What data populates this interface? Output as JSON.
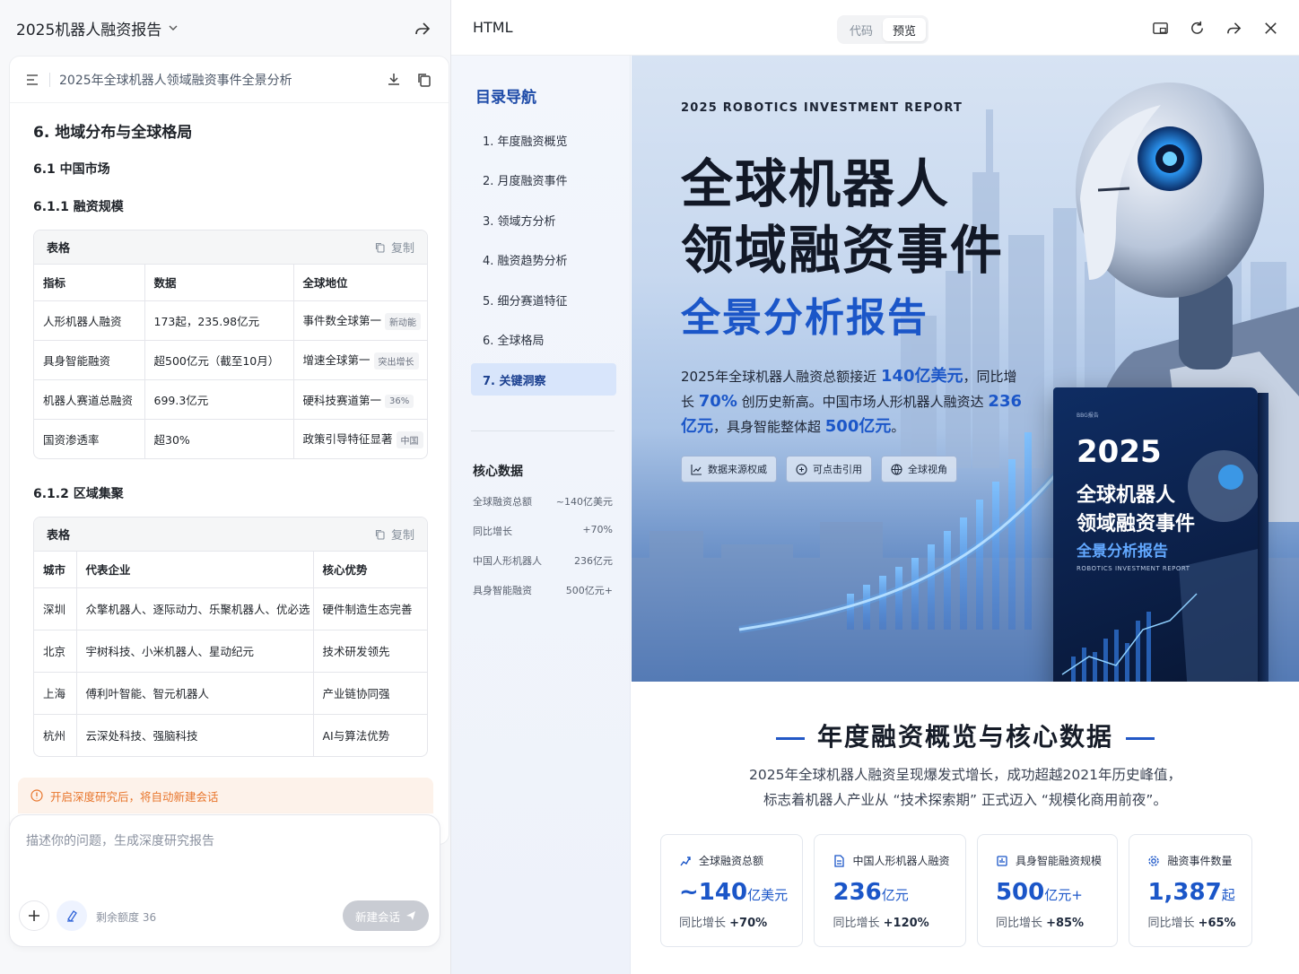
{
  "left": {
    "title": "2025机器人融资报告",
    "doc_name": "2025年全球机器人领域融资事件全景分析",
    "h1": "6. 地域分布与全球格局",
    "h2": "6.1 中国市场",
    "h3a": "6.1.1 融资规模",
    "h3b": "6.1.2 区域集聚",
    "table_label": "表格",
    "copy_label": "复制",
    "table1": {
      "headers": [
        "指标",
        "数据",
        "全球地位"
      ],
      "rows": [
        {
          "c1": "人形机器人融资",
          "c2": "173起，235.98亿元",
          "c3": "事件数全球第一",
          "tag": "新动能"
        },
        {
          "c1": "具身智能融资",
          "c2": "超500亿元（截至10月）",
          "c3": "增速全球第一",
          "tag": "突出增长"
        },
        {
          "c1": "机器人赛道总融资",
          "c2": "699.3亿元",
          "c3": "硬科技赛道第一",
          "tag": "36%"
        },
        {
          "c1": "国资渗透率",
          "c2": "超30%",
          "c3": "政策引导特征显著",
          "tag": "中国"
        }
      ]
    },
    "table2": {
      "headers": [
        "城市",
        "代表企业",
        "核心优势"
      ],
      "rows": [
        {
          "c1": "深圳",
          "c2": "众擎机器人、逐际动力、乐聚机器人、优必选",
          "c3": "硬件制造生态完善"
        },
        {
          "c1": "北京",
          "c2": "宇树科技、小米机器人、星动纪元",
          "c3": "技术研发领先"
        },
        {
          "c1": "上海",
          "c2": "傅利叶智能、智元机器人",
          "c3": "产业链协同强"
        },
        {
          "c1": "杭州",
          "c2": "云深处科技、强脑科技",
          "c3": "AI与算法优势"
        }
      ]
    },
    "notice": "开启深度研究后，将自动新建会话",
    "composer_placeholder": "描述你的问题，生成深度研究报告",
    "quota": "剩余额度 36",
    "send_label": "新建会话"
  },
  "right": {
    "title": "HTML",
    "seg_code": "代码",
    "seg_preview": "预览",
    "nav_title": "目录导航",
    "nav_items": [
      "1. 年度融资概览",
      "2. 月度融资事件",
      "3. 领域方分析",
      "4. 融资趋势分析",
      "5. 细分赛道特征",
      "6. 全球格局",
      "7. 关键洞察"
    ],
    "kd_title": "核心数据",
    "kd_rows": [
      {
        "k": "全球融资总额",
        "v": "~140亿美元"
      },
      {
        "k": "同比增长",
        "v": "+70%"
      },
      {
        "k": "中国人形机器人",
        "v": "236亿元"
      },
      {
        "k": "具身智能融资",
        "v": "500亿元+"
      }
    ],
    "hero": {
      "kicker": "2025 ROBOTICS INVESTMENT REPORT",
      "line1": "全球机器人",
      "line2": "领域融资事件",
      "line3": "全景分析报告",
      "desc_a": "2025年全球机器人融资总额接近 ",
      "desc_b": "140亿美元",
      "desc_c": "，同比增长 ",
      "desc_d": "70%",
      "desc_e": " 创历史新高。中国市场人形机器人融资达 ",
      "desc_f": "236亿元",
      "desc_g": "，具身智能整体超 ",
      "desc_h": "500亿元",
      "desc_i": "。",
      "pills": [
        "数据来源权威",
        "可点击引用",
        "全球视角"
      ],
      "book": {
        "logo": "BBG报告",
        "year": "2025",
        "t1": "全球机器人",
        "t2": "领域融资事件",
        "t3": "全景分析报告",
        "t4": "ROBOTICS INVESTMENT REPORT"
      }
    },
    "section_title": "年度融资概览与核心数据",
    "section_sub1": "2025年全球机器人融资呈现爆发式增长，成功超越2021年历史峰值，",
    "section_sub2": "标志着机器人产业从 “技术探索期” 正式迈入 “规模化商用前夜”。",
    "cards": [
      {
        "label": "全球融资总额",
        "value": "~140",
        "unit": "亿美元",
        "yoy_label": "同比增长 ",
        "yoy": "+70%"
      },
      {
        "label": "中国人形机器人融资",
        "value": "236",
        "unit": "亿元",
        "yoy_label": "同比增长 ",
        "yoy": "+120%"
      },
      {
        "label": "具身智能融资规模",
        "value": "500",
        "unit": "亿元+",
        "yoy_label": "同比增长 ",
        "yoy": "+85%"
      },
      {
        "label": "融资事件数量",
        "value": "1,387",
        "unit": "起",
        "yoy_label": "同比增长 ",
        "yoy": "+65%"
      }
    ]
  },
  "colors": {
    "accent": "#1b56c8",
    "nav_active": "#d8e5fb",
    "notice": "#e8762d"
  }
}
